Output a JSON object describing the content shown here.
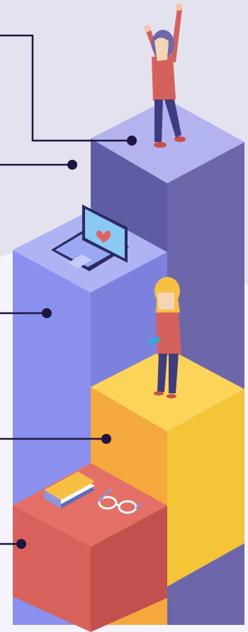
{
  "palette": {
    "background": "#f5f3fb",
    "backdrop_blob": "#e4e2ee",
    "connector_line": "#1c1640",
    "marker_dot": "#1c1640",
    "purple_top": "#b2b3ef",
    "purple_left": "#5f5ca6",
    "purple_right": "#6b67aa",
    "blue_top": "#aeb4f3",
    "blue_left": "#8b90ee",
    "blue_right": "#7c81de",
    "yellow_top": "#fbd458",
    "yellow_left": "#f5a83b",
    "yellow_right": "#f4c536",
    "red_top": "#e46f66",
    "red_left": "#d8615b",
    "red_right": "#c1504e"
  },
  "illustration": {
    "steps": [
      {
        "name": "purple-step",
        "level": 5
      },
      {
        "name": "blue-step",
        "level": 4
      },
      {
        "name": "yellow-step",
        "level": 3
      },
      {
        "name": "red-step",
        "level": 2
      }
    ],
    "objects": [
      {
        "name": "cheering-person",
        "icon": "person-arms-raised"
      },
      {
        "name": "laptop",
        "icon": "laptop-heart-icon"
      },
      {
        "name": "person-with-phone",
        "icon": "person-phone"
      },
      {
        "name": "book",
        "icon": "book-icon"
      },
      {
        "name": "glasses",
        "icon": "glasses-icon"
      }
    ],
    "markers": 5
  }
}
